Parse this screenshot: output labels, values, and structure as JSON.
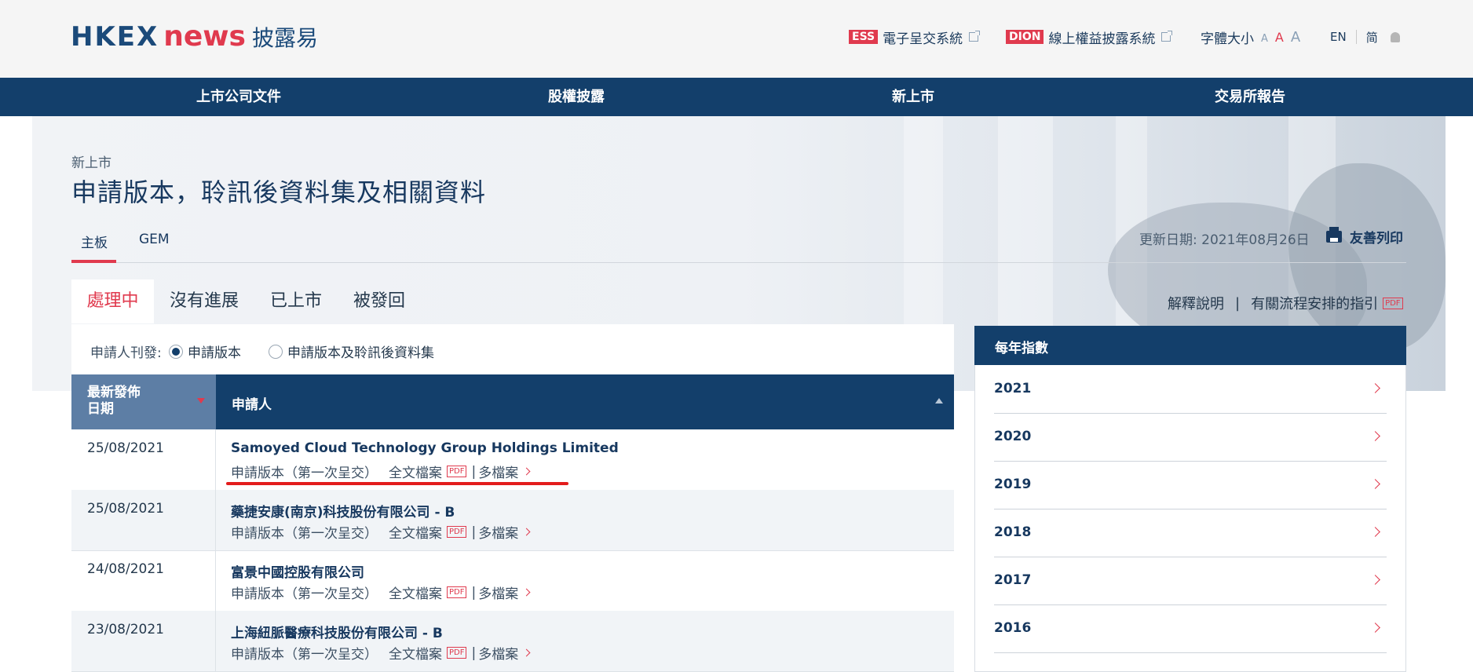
{
  "header": {
    "logo_hkex": "HKEX",
    "logo_news": "news",
    "logo_zh": "披露易",
    "ess_tag": "ESS",
    "ess_label": "電子呈交系統",
    "dion_tag": "DION",
    "dion_label": "線上權益披露系統",
    "font_size_label": "字體大小",
    "font_sizes": [
      "A",
      "A",
      "A"
    ],
    "lang_en": "EN",
    "lang_simplified": "简"
  },
  "nav": [
    "上市公司文件",
    "股權披露",
    "新上市",
    "交易所報告"
  ],
  "breadcrumb": "新上市",
  "page_title": "申請版本，聆訊後資料集及相關資料",
  "board_tabs": [
    "主板",
    "GEM"
  ],
  "updated": "更新日期: 2021年08月26日",
  "print_label": "友善列印",
  "status_tabs": [
    "處理中",
    "沒有進展",
    "已上市",
    "被發回"
  ],
  "links": {
    "explain": "解釋說明",
    "separator": "|",
    "guide": "有關流程安排的指引",
    "pdf": "PDF"
  },
  "filter": {
    "label": "申請人刊發:",
    "option_1": "申請版本",
    "option_2": "申請版本及聆訊後資料集",
    "selected": "申請版本"
  },
  "table": {
    "col_date": "最新發佈\n日期",
    "col_date_line1": "最新發佈",
    "col_date_line2": "日期",
    "col_applicant": "申請人",
    "rows": [
      {
        "date": "25/08/2021",
        "name": "Samoyed Cloud Technology Group Holdings Limited",
        "doc": "申請版本（第一次呈交）",
        "full": "全文檔案",
        "pdf": "PDF",
        "pipe": "|",
        "multi": "多檔案"
      },
      {
        "date": "25/08/2021",
        "name": "藥捷安康(南京)科技股份有限公司 - B",
        "doc": "申請版本（第一次呈交）",
        "full": "全文檔案",
        "pdf": "PDF",
        "pipe": "|",
        "multi": "多檔案"
      },
      {
        "date": "24/08/2021",
        "name": "富景中國控股有限公司",
        "doc": "申請版本（第一次呈交）",
        "full": "全文檔案",
        "pdf": "PDF",
        "pipe": "|",
        "multi": "多檔案"
      },
      {
        "date": "23/08/2021",
        "name": "上海紐脈醫療科技股份有限公司 - B",
        "doc": "申請版本（第一次呈交）",
        "full": "全文檔案",
        "pdf": "PDF",
        "pipe": "|",
        "multi": "多檔案"
      }
    ]
  },
  "sidebar": {
    "title": "每年指數",
    "years": [
      "2021",
      "2020",
      "2019",
      "2018",
      "2017",
      "2016"
    ]
  },
  "colors": {
    "navy": "#133f6b",
    "accent_red": "#e03a4e",
    "date_header": "#5d7ea5",
    "annotation_red": "#e31c1c"
  }
}
